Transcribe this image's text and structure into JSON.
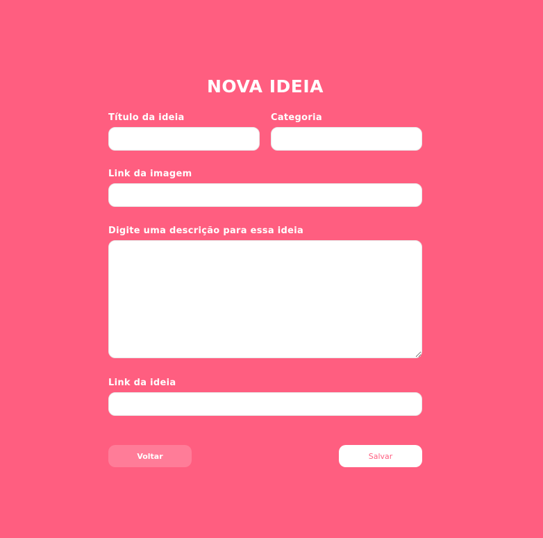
{
  "page": {
    "title": "NOVA IDEIA"
  },
  "form": {
    "title_field": {
      "label": "Título da ideia",
      "value": ""
    },
    "category_field": {
      "label": "Categoria",
      "value": ""
    },
    "image_link_field": {
      "label": "Link da imagem",
      "value": ""
    },
    "description_field": {
      "label": "Digite uma descrição para essa ideia",
      "value": ""
    },
    "idea_link_field": {
      "label": "Link da ideia",
      "value": ""
    }
  },
  "actions": {
    "back_label": "Voltar",
    "save_label": "Salvar"
  },
  "colors": {
    "background": "#ff5e80",
    "back_button": "#ff7c98",
    "save_text": "#ff5e80",
    "field_background": "#ffffff"
  }
}
